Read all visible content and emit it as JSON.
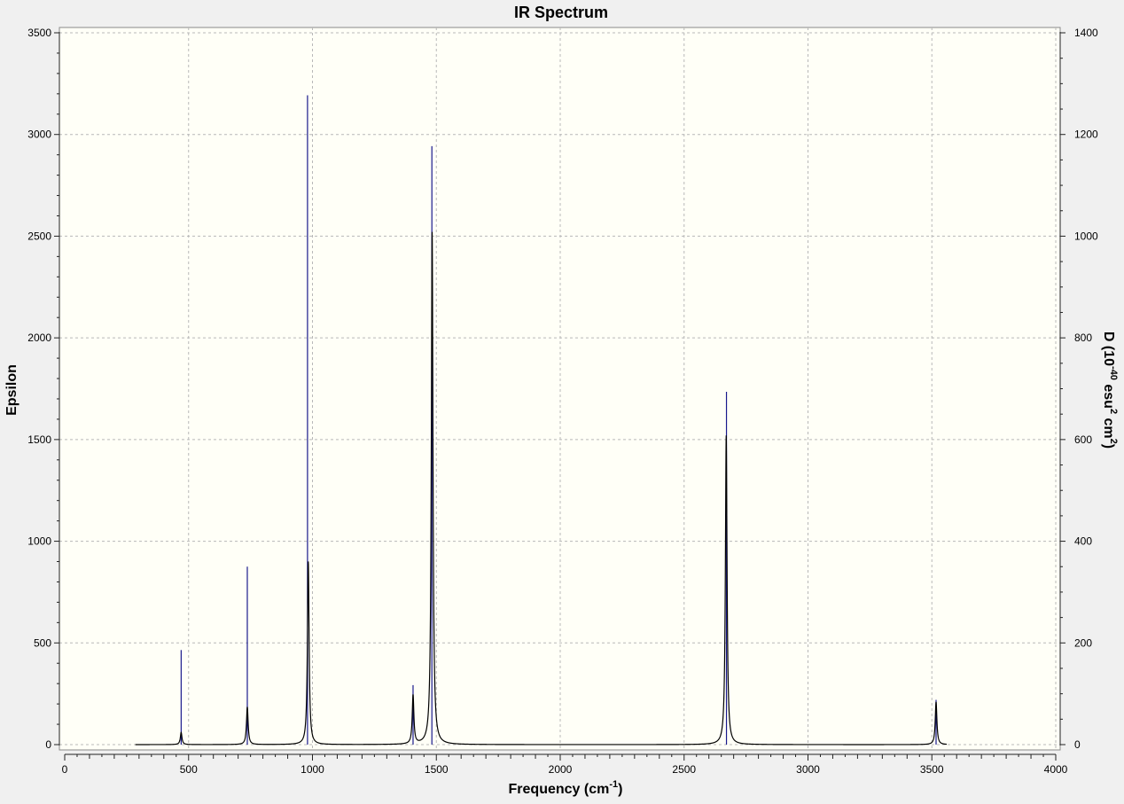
{
  "chart_data": {
    "type": "line",
    "title": "IR Spectrum",
    "xlabel": {
      "base": "Frequency (cm",
      "sup": "-1",
      "end": ")"
    },
    "ylabel": "Epsilon",
    "y2label": {
      "a": "D (10",
      "sup1": "-40",
      "b": " esu",
      "sup2": "2",
      "c": " cm",
      "sup3": "2",
      "d": ")"
    },
    "xlim": [
      0,
      4000
    ],
    "ylim": [
      0,
      3500
    ],
    "y2lim": [
      0,
      1400
    ],
    "xticks": [
      0,
      500,
      1000,
      1500,
      2000,
      2500,
      3000,
      3500,
      4000
    ],
    "yticks": [
      0,
      500,
      1000,
      1500,
      2000,
      2500,
      3000,
      3500
    ],
    "y2ticks": [
      0,
      200,
      400,
      600,
      800,
      1000,
      1200,
      1400
    ],
    "grid": true,
    "spectrum_range": [
      285,
      3560
    ],
    "series": [
      {
        "kind": "lorentzian-spectrum",
        "axis": "left",
        "color": "#000000",
        "peaks": [
          {
            "x": 470,
            "y": 60,
            "width": 8
          },
          {
            "x": 737,
            "y": 185,
            "width": 8
          },
          {
            "x": 983,
            "y": 900,
            "width": 8
          },
          {
            "x": 1406,
            "y": 240,
            "width": 8
          },
          {
            "x": 1483,
            "y": 2520,
            "width": 8
          },
          {
            "x": 2670,
            "y": 1520,
            "width": 8
          },
          {
            "x": 3517,
            "y": 210,
            "width": 8
          }
        ]
      },
      {
        "kind": "stick",
        "axis": "right",
        "color": "#1a1a8c",
        "x": [
          470,
          737,
          980,
          1406,
          1482,
          2671,
          3517
        ],
        "y": [
          186,
          350,
          1277,
          117,
          1177,
          694,
          88
        ]
      }
    ]
  },
  "colors": {
    "plot_background": "#fffff7",
    "outer_background": "#f0f0f0",
    "grid": "#b8b8b8",
    "axis": "#222222"
  }
}
